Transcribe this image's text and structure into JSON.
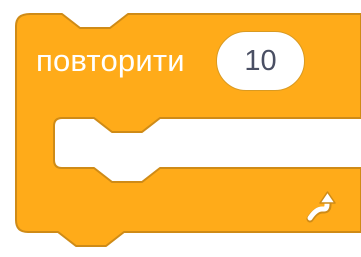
{
  "block": {
    "label": "повторити",
    "count": "10",
    "arrow_icon": "loop-arrow-icon",
    "fill_color": "#FFAB19",
    "stroke_color": "#CF8B17",
    "slot_color": "#FFFFFF"
  }
}
